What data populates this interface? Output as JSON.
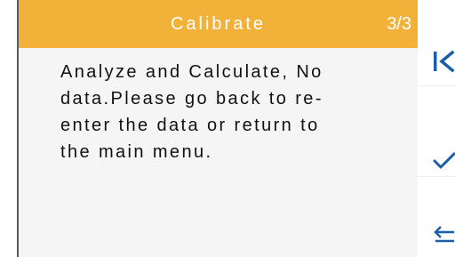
{
  "dialog": {
    "title": "Calibrate",
    "page_indicator": "3/3",
    "message": "Analyze and Calculate, No\ndata.Please go back to re-\nenter the data or return to\nthe main menu."
  },
  "side_buttons": [
    {
      "icon": "first-page-icon"
    },
    {
      "icon": "check-icon"
    },
    {
      "icon": "back-arrow-icon"
    }
  ],
  "colors": {
    "header": "#f2b23a",
    "dialog_background": "#f5f5f5",
    "icon_accent": "#1a5ea8"
  }
}
